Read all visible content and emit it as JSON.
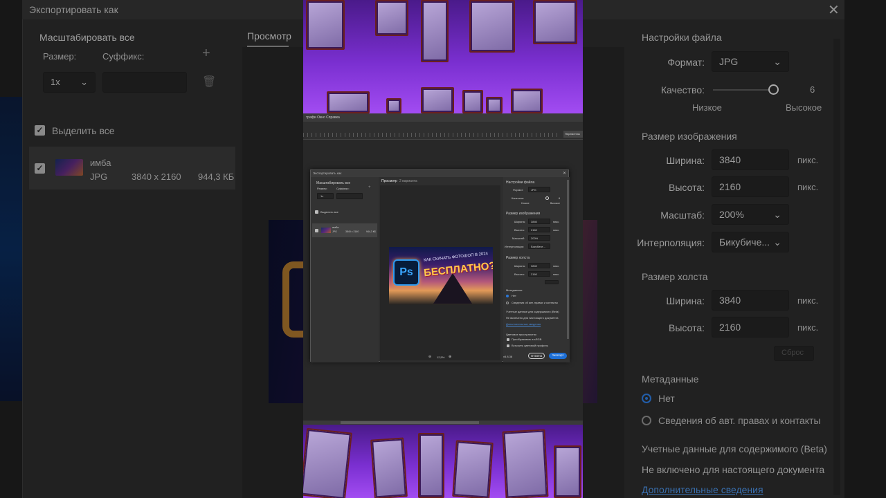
{
  "background_dialog": {
    "title": "Экспортировать как",
    "close_glyph": "✕",
    "left": {
      "scale_all": "Масштабировать все",
      "size_label": "Размер:",
      "suffix_label": "Суффикс:",
      "size_value": "1x",
      "add_glyph": "+",
      "trash_glyph": "🗑",
      "select_all": "Выделить все",
      "item": {
        "name": "имба",
        "format": "JPG",
        "dims": "3840 x 2160",
        "filesize": "944,3 КБ"
      }
    },
    "preview_tab": "Просмотр",
    "right": {
      "file_settings": "Настройки файла",
      "format_label": "Формат:",
      "format_value": "JPG",
      "quality_label": "Качество:",
      "quality_value": "6",
      "quality_low": "Низкое",
      "quality_high": "Высокое",
      "image_size": "Размер изображения",
      "width_label": "Ширина:",
      "width_value": "3840",
      "height_label": "Высота:",
      "height_value": "2160",
      "unit": "пикс.",
      "scale_label": "Масштаб:",
      "scale_value": "200%",
      "interp_label": "Интерполяция:",
      "interp_value": "Бикубиче...",
      "canvas_size": "Размер холста",
      "canvas_width_value": "3840",
      "canvas_height_value": "2160",
      "reset_label": "Сброс",
      "metadata": "Метаданные",
      "meta_none": "Нет",
      "meta_copyright": "Сведения об авт. правах и контакты",
      "content_credentials": "Учетные данные для содержимого (Beta)",
      "not_enabled": "Не включено для настоящего документа",
      "more_info": "Дополнительные сведения"
    }
  },
  "video": {
    "ps_menu": "трафи  Окно  Справка",
    "ruler_tag": "Переменны",
    "dialog": {
      "title": "Экспортировать как",
      "close_glyph": "✕",
      "scale_all": "Масштабировать все",
      "size_label": "Размер:",
      "suffix_label": "Суффикс:",
      "size_value": "1x",
      "select_all": "Выделить все",
      "item_name": "имба",
      "item_format": "JPG",
      "item_dims": "3840 x 2160",
      "item_size": "944,3 КБ",
      "tab_preview": "Просмотр",
      "tab_2up": "2 варианта",
      "preview": {
        "logo": "Ps",
        "line1": "КАК СКАЧАТЬ ФОТОШОП В 2024",
        "line2": "БЕСПЛАТНО?"
      },
      "zoom": "12,5%",
      "file_settings": "Настройки файла",
      "format_label": "Формат:",
      "format_value": "JPG",
      "quality_label": "Качество:",
      "quality_value": "6",
      "quality_low": "Низкое",
      "quality_high": "Высокое",
      "image_size": "Размер изображения",
      "width_label": "Ширина:",
      "width_value": "3840",
      "height_label": "Высота:",
      "height_value": "2160",
      "unit": "пикс.",
      "scale_label": "Масштаб:",
      "scale_value": "200%",
      "interp_label": "Интерполяция:",
      "interp_value": "Бикубиче...",
      "canvas_size": "Размер холста",
      "canvas_width_label": "Ширина:",
      "canvas_width_value": "3840",
      "canvas_height_label": "Высота:",
      "canvas_height_value": "2160",
      "metadata": "Метаданные",
      "meta_none": "Нет",
      "meta_copyright": "Сведения об авт. правах и контакты",
      "content_credentials": "Учетные данные для содержимого (Beta)",
      "not_enabled": "Не включено для настоящего документа",
      "more_info": "Дополнительные сведения",
      "color_space": "Цветовое пространство",
      "convert_srgb": "Преобразовать в sRGB",
      "embed_profile": "Встроить цветовой профиль",
      "version": "v5.8.38",
      "cancel": "Отмена",
      "export": "Экспорт"
    }
  }
}
